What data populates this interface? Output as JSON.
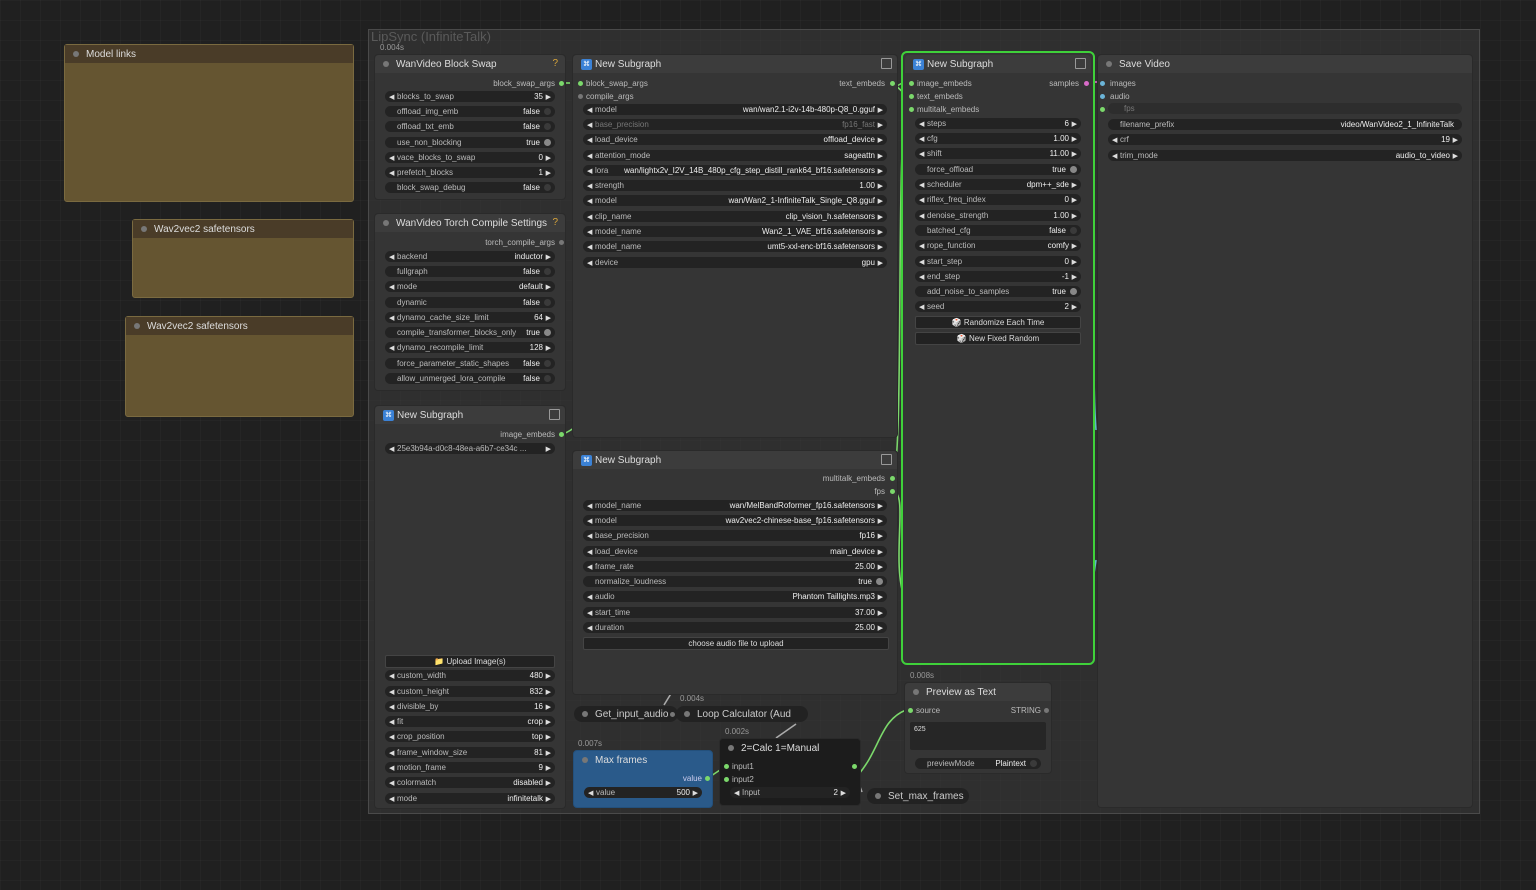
{
  "group": {
    "title": "LipSync (InfiniteTalk)",
    "timing": "0.004s"
  },
  "notes": [
    {
      "title": "Model links"
    },
    {
      "title": "Wav2vec2 safetensors"
    },
    {
      "title": "Wav2vec2 safetensors"
    }
  ],
  "block_swap": {
    "title": "WanVideo Block Swap",
    "output": "block_swap_args",
    "widgets": [
      {
        "label": "blocks_to_swap",
        "value": "35"
      },
      {
        "label": "offload_img_emb",
        "value": "false"
      },
      {
        "label": "offload_txt_emb",
        "value": "false"
      },
      {
        "label": "use_non_blocking",
        "value": "true"
      },
      {
        "label": "vace_blocks_to_swap",
        "value": "0"
      },
      {
        "label": "prefetch_blocks",
        "value": "1"
      },
      {
        "label": "block_swap_debug",
        "value": "false"
      }
    ]
  },
  "torch_compile": {
    "title": "WanVideo Torch Compile Settings",
    "output": "torch_compile_args",
    "widgets": [
      {
        "label": "backend",
        "value": "inductor"
      },
      {
        "label": "fullgraph",
        "value": "false"
      },
      {
        "label": "mode",
        "value": "default"
      },
      {
        "label": "dynamic",
        "value": "false"
      },
      {
        "label": "dynamo_cache_size_limit",
        "value": "64"
      },
      {
        "label": "compile_transformer_blocks_only",
        "value": "true"
      },
      {
        "label": "dynamo_recompile_limit",
        "value": "128"
      },
      {
        "label": "force_parameter_static_shapes",
        "value": "false"
      },
      {
        "label": "allow_unmerged_lora_compile",
        "value": "false"
      }
    ]
  },
  "subgraph_image": {
    "title": "New Subgraph",
    "output": "image_embeds",
    "image_value": "25e3b94a-d0c8-48ea-a6b7-ce34c ...",
    "upload": "📁 Upload Image(s)",
    "widgets": [
      {
        "label": "custom_width",
        "value": "480"
      },
      {
        "label": "custom_height",
        "value": "832"
      },
      {
        "label": "divisible_by",
        "value": "16"
      },
      {
        "label": "fit",
        "value": "crop"
      },
      {
        "label": "crop_position",
        "value": "top"
      },
      {
        "label": "frame_window_size",
        "value": "81"
      },
      {
        "label": "motion_frame",
        "value": "9"
      },
      {
        "label": "colormatch",
        "value": "disabled"
      },
      {
        "label": "mode",
        "value": "infinitetalk"
      }
    ]
  },
  "subgraph_model": {
    "title": "New Subgraph",
    "inputs": [
      "block_swap_args",
      "compile_args"
    ],
    "output": "text_embeds",
    "widgets": [
      {
        "label": "model",
        "value": "wan/wan2.1-i2v-14b-480p-Q8_0.gguf"
      },
      {
        "label": "base_precision",
        "value": "fp16_fast"
      },
      {
        "label": "load_device",
        "value": "offload_device"
      },
      {
        "label": "attention_mode",
        "value": "sageattn"
      },
      {
        "label": "lora",
        "value": "wan/lightx2v_I2V_14B_480p_cfg_step_distill_rank64_bf16.safetensors"
      },
      {
        "label": "strength",
        "value": "1.00"
      },
      {
        "label": "model",
        "value": "wan/Wan2_1-InfiniteTalk_Single_Q8.gguf"
      },
      {
        "label": "clip_name",
        "value": "clip_vision_h.safetensors"
      },
      {
        "label": "model_name",
        "value": "Wan2_1_VAE_bf16.safetensors"
      },
      {
        "label": "model_name",
        "value": "umt5-xxl-enc-bf16.safetensors"
      },
      {
        "label": "device",
        "value": "gpu"
      }
    ]
  },
  "subgraph_audio": {
    "title": "New Subgraph",
    "outputs": [
      "multitalk_embeds",
      "fps"
    ],
    "widgets": [
      {
        "label": "model_name",
        "value": "wan/MelBandRoformer_fp16.safetensors"
      },
      {
        "label": "model",
        "value": "wav2vec2-chinese-base_fp16.safetensors"
      },
      {
        "label": "base_precision",
        "value": "fp16"
      },
      {
        "label": "load_device",
        "value": "main_device"
      },
      {
        "label": "frame_rate",
        "value": "25.00"
      },
      {
        "label": "normalize_loudness",
        "value": "true"
      },
      {
        "label": "audio",
        "value": "Phantom Taillights.mp3"
      },
      {
        "label": "start_time",
        "value": "37.00"
      },
      {
        "label": "duration",
        "value": "25.00"
      }
    ],
    "upload": "choose audio file to upload"
  },
  "subgraph_sampler": {
    "title": "New Subgraph",
    "inputs": [
      "image_embeds",
      "text_embeds",
      "multitalk_embeds"
    ],
    "output": "samples",
    "widgets": [
      {
        "label": "steps",
        "value": "6"
      },
      {
        "label": "cfg",
        "value": "1.00"
      },
      {
        "label": "shift",
        "value": "11.00"
      },
      {
        "label": "force_offload",
        "value": "true"
      },
      {
        "label": "scheduler",
        "value": "dpm++_sde"
      },
      {
        "label": "riflex_freq_index",
        "value": "0"
      },
      {
        "label": "denoise_strength",
        "value": "1.00"
      },
      {
        "label": "batched_cfg",
        "value": "false"
      },
      {
        "label": "rope_function",
        "value": "comfy"
      },
      {
        "label": "start_step",
        "value": "0"
      },
      {
        "label": "end_step",
        "value": "-1"
      },
      {
        "label": "add_noise_to_samples",
        "value": "true"
      },
      {
        "label": "seed",
        "value": "2"
      }
    ],
    "buttons": [
      "🎲 Randomize Each Time",
      "🎲 New Fixed Random"
    ]
  },
  "save_video": {
    "title": "Save Video",
    "inputs": [
      "images",
      "audio",
      "fps"
    ],
    "widgets": [
      {
        "label": "filename_prefix",
        "value": "video/WanVideo2_1_InfiniteTalk"
      },
      {
        "label": "crf",
        "value": "19"
      },
      {
        "label": "trim_mode",
        "value": "audio_to_video"
      }
    ]
  },
  "preview_text": {
    "timing": "0.008s",
    "title": "Preview as Text",
    "input": "source",
    "input_type": "STRING",
    "content": "625",
    "mode_label": "previewMode",
    "mode_value": "Plaintext"
  },
  "get_input_audio": {
    "title": "Get_input_audio"
  },
  "loop_calc": {
    "title": "Loop Calculator (Aud",
    "timing": "0.004s"
  },
  "max_frames": {
    "timing": "0.007s",
    "title": "Max frames",
    "output": "value",
    "widget_label": "value",
    "widget_value": "500"
  },
  "calc": {
    "timing": "0.002s",
    "title": "2=Calc 1=Manual",
    "inputs": [
      "input1",
      "input2"
    ],
    "widget_label": "Input",
    "widget_value": "2"
  },
  "set_max_frames": {
    "title": "Set_max_frames"
  },
  "colors": {
    "accent_selected": "#3fd13a",
    "link_green": "#7bd86b",
    "link_blue": "#5fb8c8",
    "note": "#655531",
    "max_frames_node": "#2a5a8a"
  }
}
